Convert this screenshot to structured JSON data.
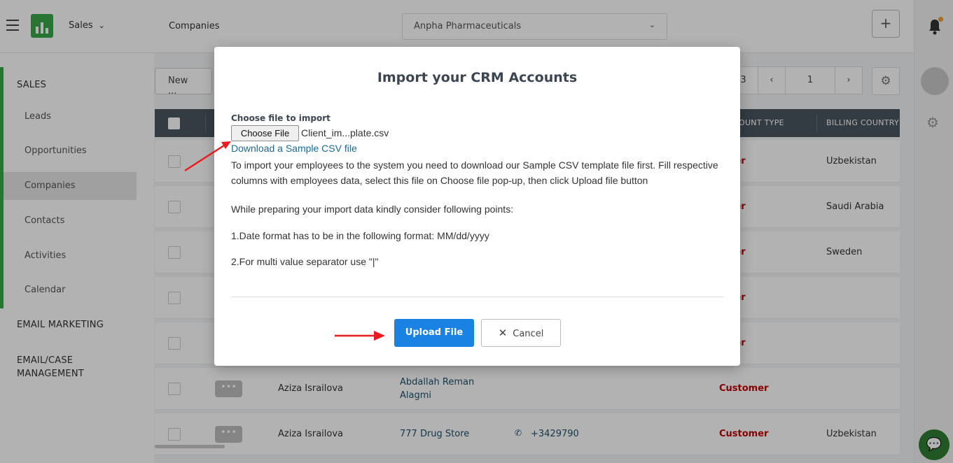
{
  "header": {
    "module": "Sales",
    "breadcrumb": "Companies",
    "company": "Anpha Pharmaceuticals",
    "plus_label": "+"
  },
  "sidebar": {
    "section_sales": "SALES",
    "items": [
      "Leads",
      "Opportunities",
      "Companies",
      "Contacts",
      "Activities",
      "Calendar"
    ],
    "section_email": "EMAIL MARKETING",
    "section_case": [
      "EMAIL/CASE",
      "MANAGEMENT"
    ]
  },
  "toolbar": {
    "new_label": "New ...",
    "page_info": "3",
    "current_page": "1"
  },
  "table": {
    "headers": {
      "account_type": "OUNT TYPE",
      "billing_country": "BILLING COUNTRY"
    },
    "rows": [
      {
        "owner": "",
        "company": "",
        "phone": "",
        "type": "omer",
        "country": "Uzbekistan"
      },
      {
        "owner": "",
        "company": "",
        "phone": "",
        "type": "omer",
        "country": "Saudi Arabia"
      },
      {
        "owner": "",
        "company": "",
        "phone": "",
        "type": "omer",
        "country": "Sweden"
      },
      {
        "owner": "",
        "company": "",
        "phone": "",
        "type": "omer",
        "country": ""
      },
      {
        "owner": "",
        "company": "",
        "phone": "",
        "type": "omer",
        "country": ""
      },
      {
        "owner": "Aziza Israilova",
        "company": "Abdallah Reman",
        "company2": "Alagmi",
        "phone": "",
        "type": "Customer",
        "country": ""
      },
      {
        "owner": "Aziza Israilova",
        "company": "777 Drug Store",
        "phone": "+3429790",
        "type": "Customer",
        "country": "Uzbekistan"
      }
    ]
  },
  "modal": {
    "title": "Import your CRM Accounts",
    "file_label": "Choose file to import",
    "choose_button": "Choose File",
    "file_name": "Client_im...plate.csv",
    "sample_link": "Download a Sample CSV file",
    "instructions": "To import your employees to the system you need to download our Sample CSV template file first. Fill respective columns with employees data, select this file on Choose file pop-up, then click Upload file button",
    "consider": "While preparing your import data kindly consider following points:",
    "point1": "1.Date format has to be in the following format: MM/dd/yyyy",
    "point2": "2.For multi value separator use \"|\"",
    "upload_button": "Upload File",
    "cancel_button": "Cancel"
  },
  "colors": {
    "accent": "#3aa84a",
    "primary_button": "#1a82e2",
    "annotation_arrow": "#e81c1c",
    "customer": "#c00000"
  }
}
